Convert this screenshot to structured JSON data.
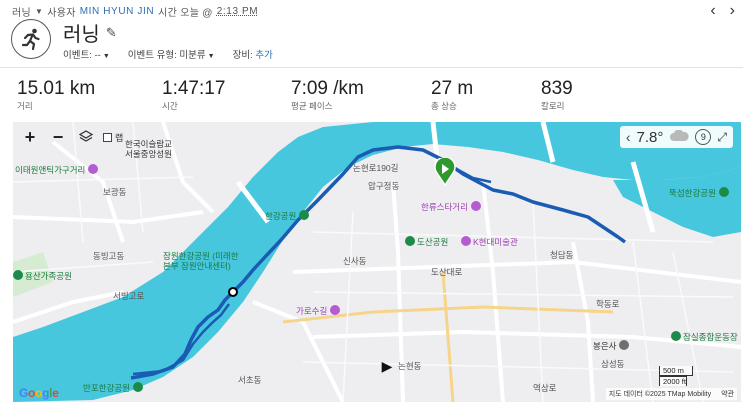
{
  "header": {
    "breadcrumb_sport": "러닝",
    "breadcrumb_user_prefix": "사용자",
    "user_name": "MIN HYUN JIN",
    "time_prefix": "시간 오늘 @",
    "time": "2:13 PM",
    "prev_icon": "chevron-left-icon",
    "next_icon": "chevron-right-icon"
  },
  "activity": {
    "title": "러닝",
    "avatar_icon": "running-person-icon",
    "event_label": "이벤트:",
    "event_value": "--",
    "event_type_label": "이벤트 유형:",
    "event_type_value": "미분류",
    "gear_label": "장비:",
    "gear_value": "추가"
  },
  "stats": [
    {
      "value": "15.01 km",
      "label": "거리"
    },
    {
      "value": "1:47:17",
      "label": "시간"
    },
    {
      "value": "7:09 /km",
      "label": "평균 페이스"
    },
    {
      "value": "27 m",
      "label": "총 상승"
    },
    {
      "value": "839",
      "label": "칼로리"
    }
  ],
  "map": {
    "layer_label": "랩",
    "temperature": "7.8°",
    "wind_speed": "9",
    "scale_top": "500 m",
    "scale_bottom": "2000 ft",
    "attribution": "지도 데이터 ©2025 TMap Mobility",
    "terms": "약관",
    "google_letters": [
      "G",
      "o",
      "o",
      "g",
      "l",
      "e"
    ],
    "labels": {
      "itaewon_furniture": "이태원앤틱가구거리",
      "school": "한국이슬람교\n서울중앙성원",
      "bogwang": "보광동",
      "yongsan_family": "용산가족공원",
      "hangang_park": "한강공원",
      "jamwon": "잠원한강공원 (미래한",
      "jamwon2": "본부 잠원안내센터)",
      "hanryu": "한류스타거리",
      "dosan": "도산공원",
      "k_museum": "K현대미술관",
      "garosu": "가로수길",
      "ttukseom": "뚝섬한강공원",
      "jamsil": "잠실종합운동장",
      "bongeunsa": "봉은사",
      "banpo": "반포한강공원",
      "nonhyeon190": "논현로190길",
      "apgujeong": "압구정동",
      "sinsa": "신사동",
      "cheongdam": "청담동",
      "hakdong": "학동로",
      "nonhyeondong": "논현동",
      "samseong": "삼성동",
      "yeoksam": "역삼로",
      "seobinggo": "서빙고로",
      "dongbinggo": "동빙고동",
      "seocho": "서초동",
      "dosan_daero": "도산대로"
    }
  }
}
